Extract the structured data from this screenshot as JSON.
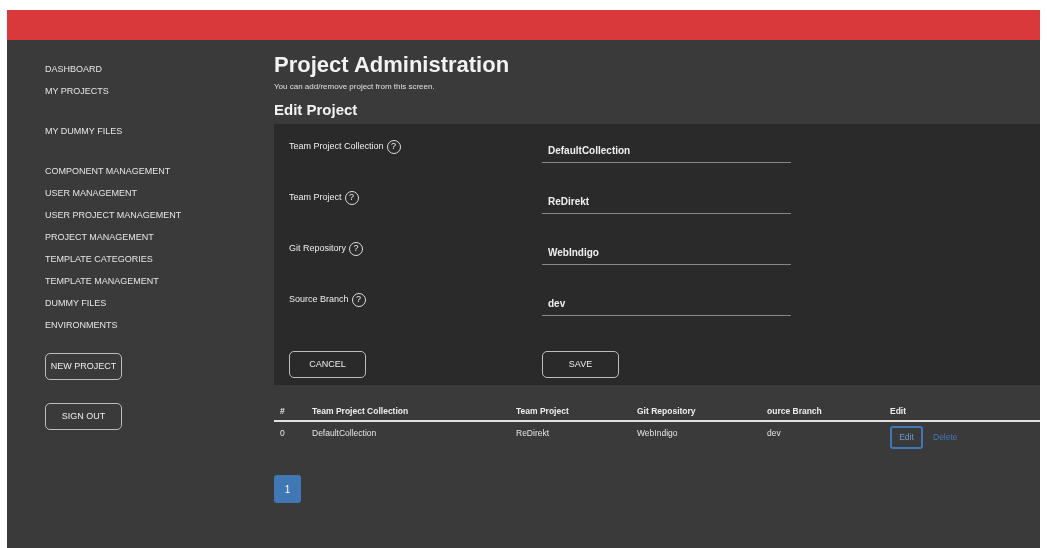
{
  "sidebar": {
    "groups": [
      {
        "items": [
          "DASHBOARD",
          "MY PROJECTS"
        ]
      },
      {
        "items": [
          "MY DUMMY FILES"
        ]
      },
      {
        "items": [
          "COMPONENT MANAGEMENT",
          "USER MANAGEMENT",
          "USER PROJECT MANAGEMENT",
          "PROJECT MANAGEMENT",
          "TEMPLATE CATEGORIES",
          "TEMPLATE MANAGEMENT",
          "DUMMY FILES",
          "ENVIRONMENTS"
        ]
      }
    ],
    "buttons": [
      "NEW PROJECT",
      "SIGN OUT"
    ]
  },
  "page": {
    "title": "Project Administration",
    "subtitle": "You can add/remove project from this screen.",
    "section_title": "Edit Project"
  },
  "form": {
    "fields": [
      {
        "label": "Team Project Collection",
        "help": "?",
        "value": "DefaultCollection"
      },
      {
        "label": "Team Project",
        "help": "?",
        "value": "ReDirekt"
      },
      {
        "label": "Git Repository",
        "help": "?",
        "value": "WebIndigo"
      },
      {
        "label": "Source Branch",
        "help": "?",
        "value": "dev"
      }
    ],
    "buttons": [
      "CANCEL",
      "SAVE"
    ]
  },
  "table": {
    "columns": [
      "#",
      "Team Project Collection",
      "Team Project",
      "Git Repository",
      "ource Branch",
      "Edit"
    ],
    "rows": [
      {
        "cells": [
          "0",
          "DefaultCollection",
          "ReDirekt",
          "WebIndigo",
          "dev"
        ],
        "actions": [
          "Edit",
          "Delete"
        ]
      }
    ]
  },
  "pagination": [
    {
      "label": "1",
      "selected": true
    }
  ]
}
